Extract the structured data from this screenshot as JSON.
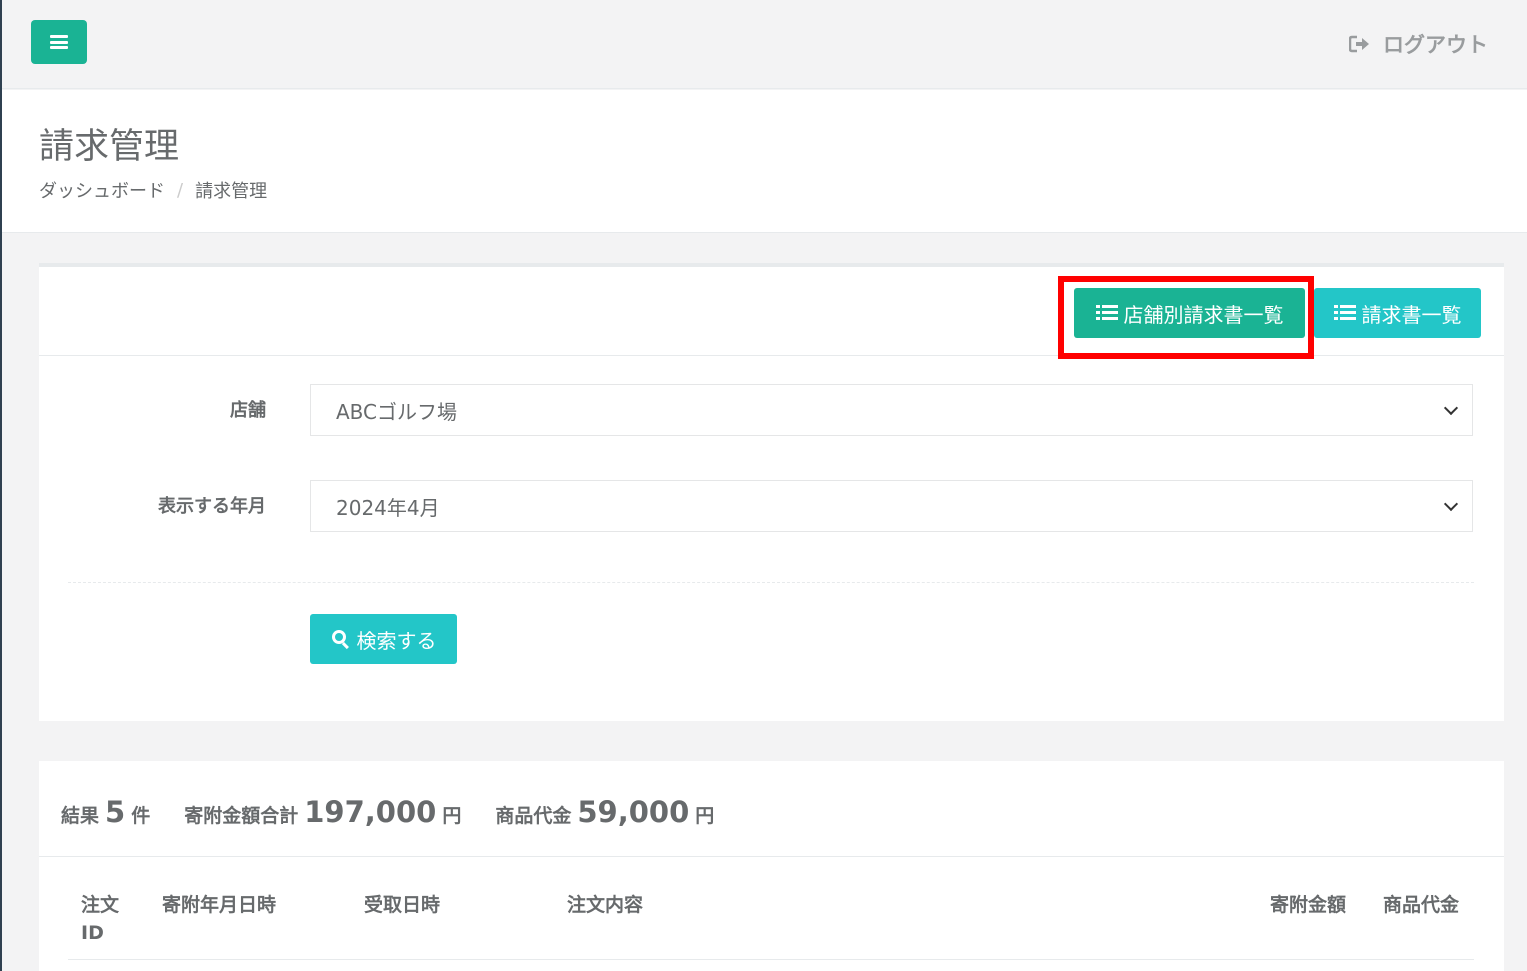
{
  "topbar": {
    "menu_icon": "hamburger-icon",
    "logout_icon": "sign-out-icon",
    "logout_label": "ログアウト"
  },
  "page": {
    "title": "請求管理",
    "breadcrumb": [
      "ダッシュボード",
      "/",
      "請求管理"
    ]
  },
  "toolbar": {
    "store_invoice_list_label": "店舗別請求書一覧",
    "invoice_list_label": "請求書一覧",
    "list_icon": "list-icon"
  },
  "form": {
    "store_label": "店舗",
    "store_value": "ABCゴルフ場",
    "month_label": "表示する年月",
    "month_value": "2024年4月",
    "search_label": "検索する",
    "search_icon": "search-icon"
  },
  "summary": {
    "results_label": "結果",
    "results_count": "5",
    "results_unit": "件",
    "donation_total_label": "寄附金額合計",
    "donation_total_value": "197,000",
    "donation_total_unit": "円",
    "product_fee_label": "商品代金",
    "product_fee_value": "59,000",
    "product_fee_unit": "円"
  },
  "table": {
    "headers": [
      "注文ID",
      "寄附年月日時",
      "受取日時",
      "注文内容",
      "寄附金額",
      "商品代金"
    ],
    "order_id_line1": "注文",
    "order_id_line2": "ID"
  },
  "colors": {
    "primary": "#1ab394",
    "info": "#23c6c8",
    "highlight": "#ff0000"
  }
}
